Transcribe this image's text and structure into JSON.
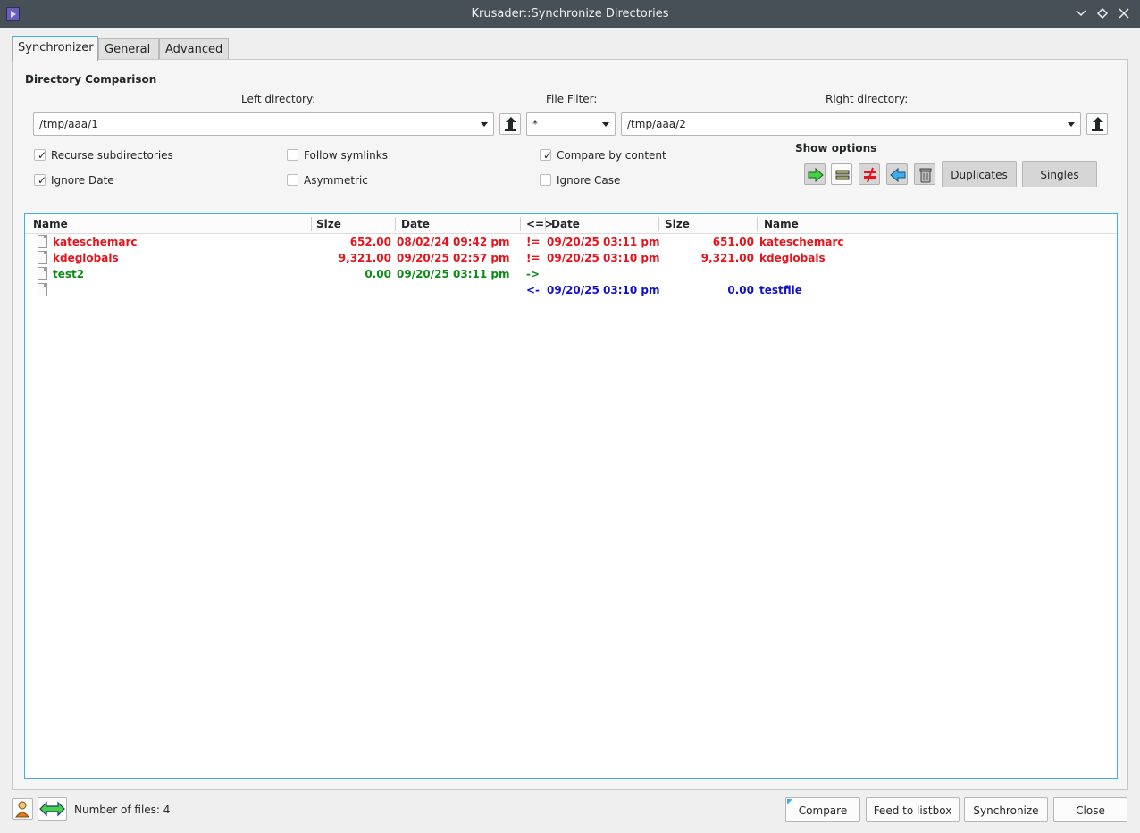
{
  "window": {
    "title": "Krusader::Synchronize Directories",
    "buttons": {
      "minimize_icon": "chevron-down-icon",
      "maximize_icon": "diamond-icon",
      "close_icon": "close-icon"
    }
  },
  "tabs": [
    {
      "label": "Synchronizer",
      "active": true
    },
    {
      "label": "General",
      "active": false
    },
    {
      "label": "Advanced",
      "active": false
    }
  ],
  "comparison": {
    "group_title": "Directory Comparison",
    "left_label": "Left directory:",
    "filter_label": "File Filter:",
    "right_label": "Right directory:",
    "left_value": "/tmp/aaa/1",
    "filter_value": "*",
    "right_value": "/tmp/aaa/2"
  },
  "checkboxes": {
    "recurse": {
      "label": "Recurse subdirectories",
      "checked": true
    },
    "follow_symlinks": {
      "label": "Follow symlinks",
      "checked": false
    },
    "compare_by_content": {
      "label": "Compare by content",
      "checked": true
    },
    "ignore_date": {
      "label": "Ignore Date",
      "checked": true
    },
    "asymmetric": {
      "label": "Asymmetric",
      "checked": false
    },
    "ignore_case": {
      "label": "Ignore Case",
      "checked": false
    }
  },
  "show_options": {
    "title": "Show options",
    "icons": [
      "right-arrow-icon",
      "equals-icon",
      "not-equal-icon",
      "left-arrow-icon",
      "trash-icon"
    ],
    "duplicates_label": "Duplicates",
    "singles_label": "Singles"
  },
  "file_list": {
    "columns": [
      "Name",
      "Size",
      "Date",
      "<=>",
      "Date",
      "Size",
      "Name"
    ],
    "rows": [
      {
        "left_name": "kateschemarc",
        "left_size": "652.00",
        "left_date": "08/02/24 09:42 pm",
        "op": "!=",
        "right_date": "09/20/25 03:11 pm",
        "right_size": "651.00",
        "right_name": "kateschemarc",
        "color": "#e8141b"
      },
      {
        "left_name": "kdeglobals",
        "left_size": "9,321.00",
        "left_date": "09/20/25 02:57 pm",
        "op": "!=",
        "right_date": "09/20/25 03:10 pm",
        "right_size": "9,321.00",
        "right_name": "kdeglobals",
        "color": "#e8141b"
      },
      {
        "left_name": "test2",
        "left_size": "0.00",
        "left_date": "09/20/25 03:11 pm",
        "op": "->",
        "right_date": "",
        "right_size": "",
        "right_name": "",
        "color": "#0e8a16"
      },
      {
        "left_name": "",
        "left_size": "",
        "left_date": "",
        "op": "<-",
        "right_date": "09/20/25 03:10 pm",
        "right_size": "0.00",
        "right_name": "testfile",
        "color": "#1111cc"
      }
    ]
  },
  "status": {
    "file_count": "Number of files: 4",
    "icons": [
      "user-icon",
      "swap-arrows-icon"
    ]
  },
  "buttons": {
    "compare": "Compare",
    "feed": "Feed to listbox",
    "synchronize": "Synchronize",
    "close": "Close"
  },
  "colors": {
    "accent": "#3daee9",
    "titlebar": "#475057",
    "different": "#e8141b",
    "copy_right": "#0e8a16",
    "copy_left": "#1111cc"
  }
}
